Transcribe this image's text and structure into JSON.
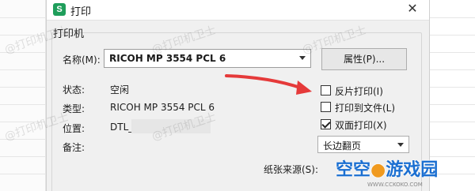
{
  "dialog": {
    "app_icon_letter": "S",
    "title": "打印",
    "close": "✕"
  },
  "printer_group": {
    "label": "打印机",
    "name_label": "名称(M):",
    "name_value": "RICOH MP 3554 PCL 6",
    "properties_button": "属性(P)...",
    "status_label": "状态:",
    "status_value": "空闲",
    "type_label": "类型:",
    "type_value": "RICOH MP 3554 PCL 6",
    "location_label": "位置:",
    "location_value": "DTL_",
    "comment_label": "备注:",
    "paper_source_label": "纸张来源(S):"
  },
  "options": {
    "reverse_print": {
      "label": "反片打印(I)",
      "checked": false
    },
    "print_to_file": {
      "label": "打印到文件(L)",
      "checked": false
    },
    "duplex_print": {
      "label": "双面打印(X)",
      "checked": true
    },
    "duplex_mode": "长边翻页"
  },
  "watermark": "@打印机卫士",
  "logo": {
    "text_a": "空空",
    "text_b": "游戏园",
    "url": "WWW.CCKOKO.COM"
  },
  "colors": {
    "app_icon": "#1f9e5b",
    "annotation_arrow": "#e53a3a",
    "logo_blue": "#1b6fd1",
    "logo_orange": "#f09a1f"
  }
}
